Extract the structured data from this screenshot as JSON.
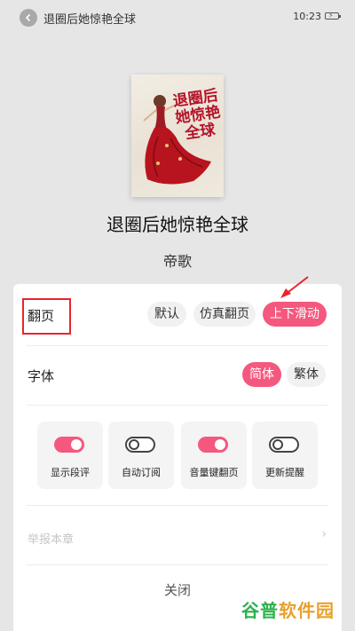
{
  "top_bar": {
    "title": "退圈后她惊艳全球",
    "time": "10:23"
  },
  "book": {
    "cover_title": "退圈后她惊艳全球",
    "cover_publisher": "",
    "title": "退圈后她惊艳全球",
    "author": "帝歌"
  },
  "settings": {
    "page_turn": {
      "label": "翻页",
      "options": [
        "默认",
        "仿真翻页",
        "上下滑动"
      ],
      "selected": "上下滑动"
    },
    "font": {
      "label": "字体",
      "options": [
        "简体",
        "繁体"
      ],
      "selected": "简体"
    },
    "toggles": [
      {
        "label": "显示段评",
        "on": true
      },
      {
        "label": "自动订阅",
        "on": false
      },
      {
        "label": "音量键翻页",
        "on": true
      },
      {
        "label": "更新提醒",
        "on": false
      }
    ],
    "report_label": "举报本章",
    "close_label": "关闭"
  },
  "colors": {
    "accent": "#f5587e",
    "annotation_red": "#e8262d"
  },
  "watermark": {
    "part1": "谷普",
    "part2": "软件园"
  }
}
